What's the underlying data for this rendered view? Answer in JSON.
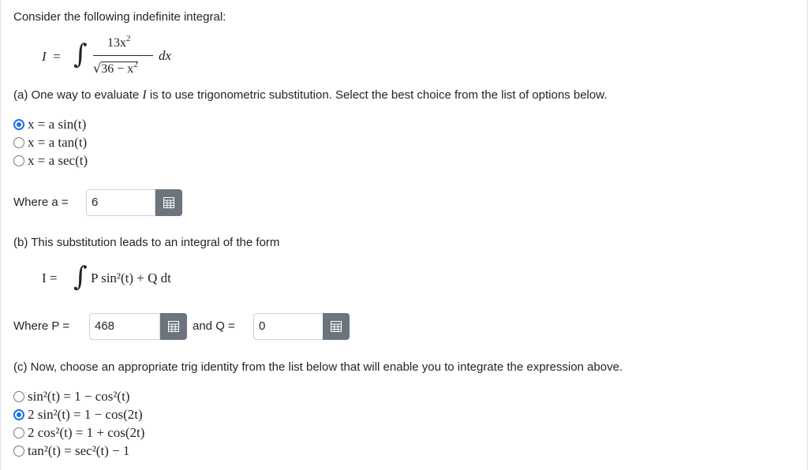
{
  "intro": "Consider the following indefinite integral:",
  "integral_lhs": "I",
  "integral_eq": "=",
  "numerator": "13x",
  "numerator_exp": "2",
  "denominator": "36 − x",
  "denominator_exp": "2",
  "dx": "dx",
  "part_a": {
    "prompt_pre": "(a) One way to evaluate ",
    "prompt_var": "I",
    "prompt_post": " is to use trigonometric substitution. Select the best choice from the list of options below.",
    "options": [
      {
        "label": "x = a sin(t)",
        "checked": true
      },
      {
        "label": "x = a tan(t)",
        "checked": false
      },
      {
        "label": "x = a sec(t)",
        "checked": false
      }
    ],
    "where_label": "Where a =",
    "a_value": "6"
  },
  "part_b": {
    "prompt": "(b) This substitution leads to an integral of the form",
    "form_lhs": "I =",
    "form_rhs": "P sin²(t) + Q dt",
    "where_p_label": "Where P =",
    "p_value": "468",
    "and_q_label": "and Q =",
    "q_value": "0"
  },
  "part_c": {
    "prompt": "(c) Now, choose an appropriate trig identity from the list below that will enable you to integrate the expression above.",
    "options": [
      {
        "label": "sin²(t) = 1 − cos²(t)",
        "checked": false
      },
      {
        "label": "2 sin²(t) = 1 − cos(2t)",
        "checked": true
      },
      {
        "label": "2 cos²(t) = 1 + cos(2t)",
        "checked": false
      },
      {
        "label": "tan²(t) = sec²(t) − 1",
        "checked": false
      }
    ]
  },
  "icons": {
    "calculator": "calculator-icon"
  },
  "colors": {
    "radio_checked": "#1a73e8",
    "button_gray": "#6c757d"
  }
}
